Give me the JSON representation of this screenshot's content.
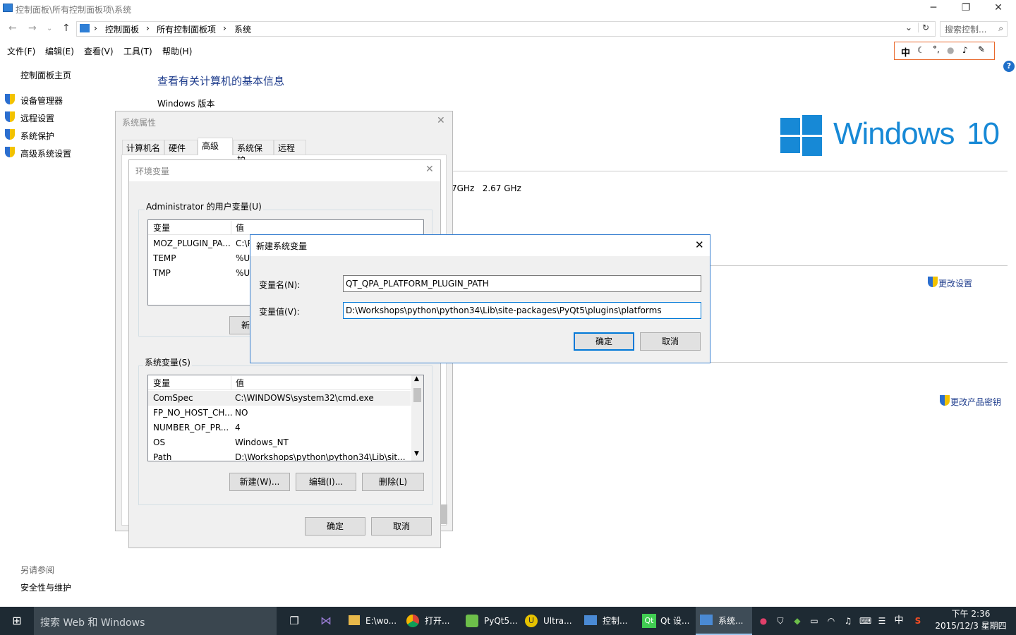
{
  "window": {
    "title": "控制面板\\所有控制面板项\\系统"
  },
  "address": {
    "crumbs": [
      "控制面板",
      "所有控制面板项",
      "系统"
    ],
    "search_placeholder": "搜索控制..."
  },
  "menu": [
    "文件(F)",
    "编辑(E)",
    "查看(V)",
    "工具(T)",
    "帮助(H)"
  ],
  "ime": {
    "label": "中"
  },
  "sidebar": {
    "home": "控制面板主页",
    "items": [
      "设备管理器",
      "远程设置",
      "系统保护",
      "高级系统设置"
    ],
    "see_also": "另请参阅",
    "security": "安全性与维护"
  },
  "main": {
    "heading": "查看有关计算机的基本信息",
    "section_windows": "Windows 版本",
    "logo_text": "Windows",
    "logo_num": "10",
    "cpu_speed": "7GHz   2.67 GHz",
    "change_settings": "更改设置",
    "change_key": "更改产品密钥"
  },
  "sysprops": {
    "title": "系统属性",
    "tabs": [
      "计算机名",
      "硬件",
      "高级",
      "系统保护",
      "远程"
    ]
  },
  "envvars": {
    "title": "环境变量",
    "user_group": "Administrator 的用户变量(U)",
    "col_var": "变量",
    "col_val": "值",
    "user_rows": [
      {
        "name": "MOZ_PLUGIN_PA...",
        "value": "C:\\P"
      },
      {
        "name": "TEMP",
        "value": "%US"
      },
      {
        "name": "TMP",
        "value": "%US"
      }
    ],
    "user_new_btn": "新",
    "sys_group": "系统变量(S)",
    "sys_rows": [
      {
        "name": "ComSpec",
        "value": "C:\\WINDOWS\\system32\\cmd.exe"
      },
      {
        "name": "FP_NO_HOST_CH...",
        "value": "NO"
      },
      {
        "name": "NUMBER_OF_PR...",
        "value": "4"
      },
      {
        "name": "OS",
        "value": "Windows_NT"
      },
      {
        "name": "Path",
        "value": "D:\\Workshops\\python\\python34\\Lib\\sit..."
      }
    ],
    "new_btn": "新建(W)...",
    "edit_btn": "编辑(I)...",
    "delete_btn": "删除(L)",
    "ok_btn": "确定",
    "cancel_btn": "取消"
  },
  "newvar": {
    "title": "新建系统变量",
    "name_label": "变量名(N):",
    "name_value": "QT_QPA_PLATFORM_PLUGIN_PATH",
    "value_label": "变量值(V):",
    "value_value": "D:\\Workshops\\python\\python34\\Lib\\site-packages\\PyQt5\\plugins\\platforms",
    "ok_btn": "确定",
    "cancel_btn": "取消"
  },
  "taskbar": {
    "search_placeholder": "搜索 Web 和 Windows",
    "apps": [
      "E:\\wo...",
      "打开...",
      "PyQt5...",
      "Ultra...",
      "控制...",
      "Qt 设...",
      "系统..."
    ],
    "ime": "中",
    "time": "下午 2:36",
    "date": "2015/12/3 星期四"
  }
}
